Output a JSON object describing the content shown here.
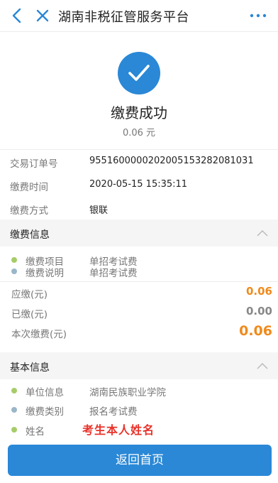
{
  "header": {
    "title": "湖南非税征管服务平台"
  },
  "hero": {
    "status": "缴费成功",
    "amount": "0.06 元"
  },
  "details": [
    {
      "label": "交易订单号",
      "value": "955160000020200515328208103​1"
    },
    {
      "label": "缴费时间",
      "value": "2020-05-15 15:35:11"
    },
    {
      "label": "缴费方式",
      "value": "银联"
    }
  ],
  "payment_info": {
    "title": "缴费信息",
    "items": [
      {
        "label": "缴费项目",
        "value": "单招考试费",
        "dot_color": "#a6cc6a"
      },
      {
        "label": "缴费说明",
        "value": "单招考试费",
        "dot_color": "#9ab6c9"
      }
    ],
    "amounts": [
      {
        "label": "应缴(元)",
        "value": "0.06",
        "color": "#f08a1c"
      },
      {
        "label": "已缴(元)",
        "value": "0.00",
        "color": "#888888"
      },
      {
        "label": "本次缴费(元)",
        "value": "0.06",
        "color": "#f08a1c"
      }
    ]
  },
  "basic_info": {
    "title": "基本信息",
    "items": [
      {
        "label": "单位信息",
        "value": "湖南民族职业学院",
        "dot_color": "#a6cc6a"
      },
      {
        "label": "缴费类别",
        "value": "报名考试费",
        "dot_color": "#9ab6c9"
      },
      {
        "label": "姓名",
        "value": "",
        "dot_color": "#a6cc6a"
      }
    ],
    "overlay_text": "考生本人姓名"
  },
  "footer": {
    "button_label": "返回首页"
  },
  "colors": {
    "accent": "#2a88d6",
    "orange": "#f08a1c",
    "overlay_red": "#e8322a"
  }
}
